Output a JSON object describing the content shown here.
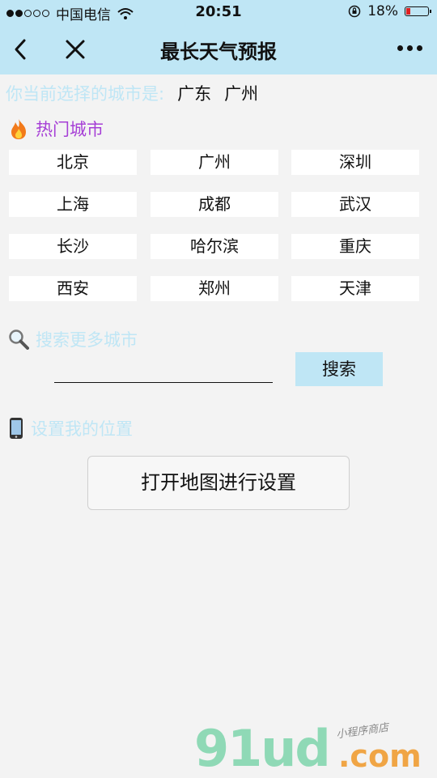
{
  "status": {
    "carrier": "中国电信",
    "time": "20:51",
    "battery": "18%"
  },
  "nav": {
    "title": "最长天气预报"
  },
  "current": {
    "label": "你当前选择的城市是:",
    "province": "广东",
    "city": "广州"
  },
  "hot": {
    "title": "热门城市",
    "cities": [
      "北京",
      "广州",
      "深圳",
      "上海",
      "成都",
      "武汉",
      "长沙",
      "哈尔滨",
      "重庆",
      "西安",
      "郑州",
      "天津"
    ]
  },
  "search": {
    "title": "搜索更多城市",
    "button": "搜索"
  },
  "location": {
    "title": "设置我的位置",
    "button": "打开地图进行设置"
  },
  "watermark": {
    "main": "91ud",
    "com": ".com",
    "sub": "小程序商店"
  }
}
